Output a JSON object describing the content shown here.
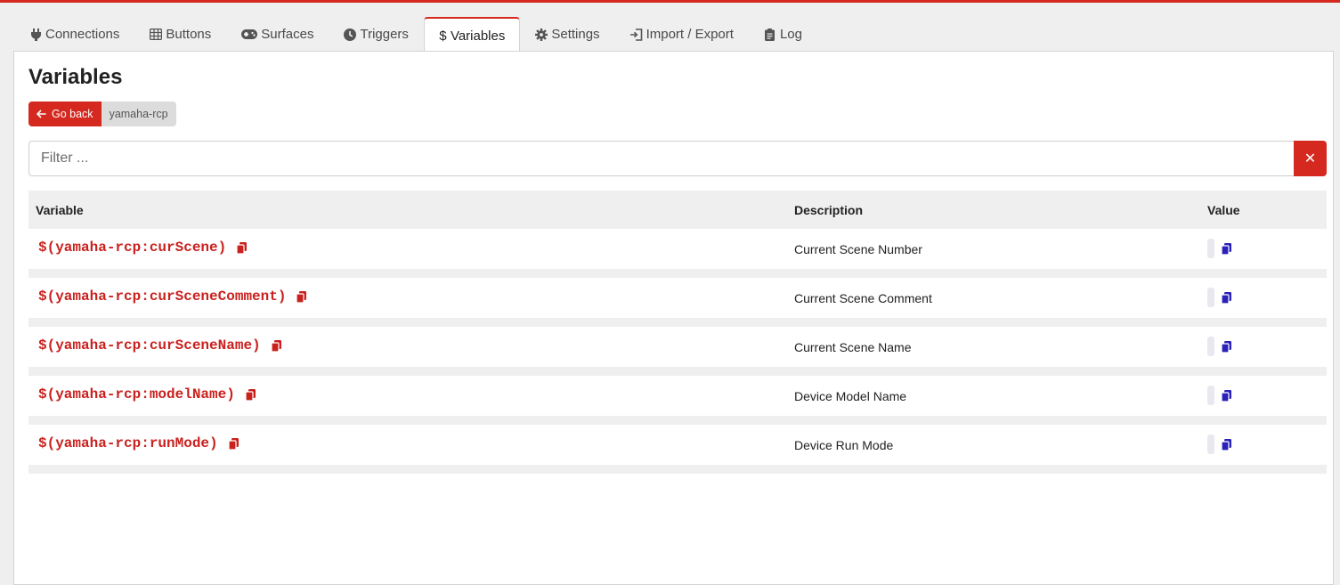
{
  "tabs": [
    {
      "label": "Connections",
      "icon": "plug-icon"
    },
    {
      "label": "Buttons",
      "icon": "grid-icon"
    },
    {
      "label": "Surfaces",
      "icon": "gamepad-icon"
    },
    {
      "label": "Triggers",
      "icon": "clock-icon"
    },
    {
      "label": "Variables",
      "icon": "dollar-icon",
      "active": true
    },
    {
      "label": "Settings",
      "icon": "gear-icon"
    },
    {
      "label": "Import / Export",
      "icon": "import-icon"
    },
    {
      "label": "Log",
      "icon": "clipboard-icon"
    }
  ],
  "page": {
    "title": "Variables",
    "back_label": "Go back",
    "connection_tag": "yamaha-rcp"
  },
  "filter": {
    "placeholder": "Filter ...",
    "value": "",
    "clear_label": "✕"
  },
  "table": {
    "headers": {
      "variable": "Variable",
      "description": "Description",
      "value": "Value"
    },
    "rows": [
      {
        "variable": "$(yamaha-rcp:curScene)",
        "description": "Current Scene Number",
        "value": ""
      },
      {
        "variable": "$(yamaha-rcp:curSceneComment)",
        "description": "Current Scene Comment",
        "value": ""
      },
      {
        "variable": "$(yamaha-rcp:curSceneName)",
        "description": "Current Scene Name",
        "value": ""
      },
      {
        "variable": "$(yamaha-rcp:modelName)",
        "description": "Device Model Name",
        "value": ""
      },
      {
        "variable": "$(yamaha-rcp:runMode)",
        "description": "Device Run Mode",
        "value": ""
      }
    ]
  },
  "colors": {
    "accent": "#d5281f",
    "variable_text": "#c9211e",
    "value_copy_icon": "#2a21b8"
  }
}
